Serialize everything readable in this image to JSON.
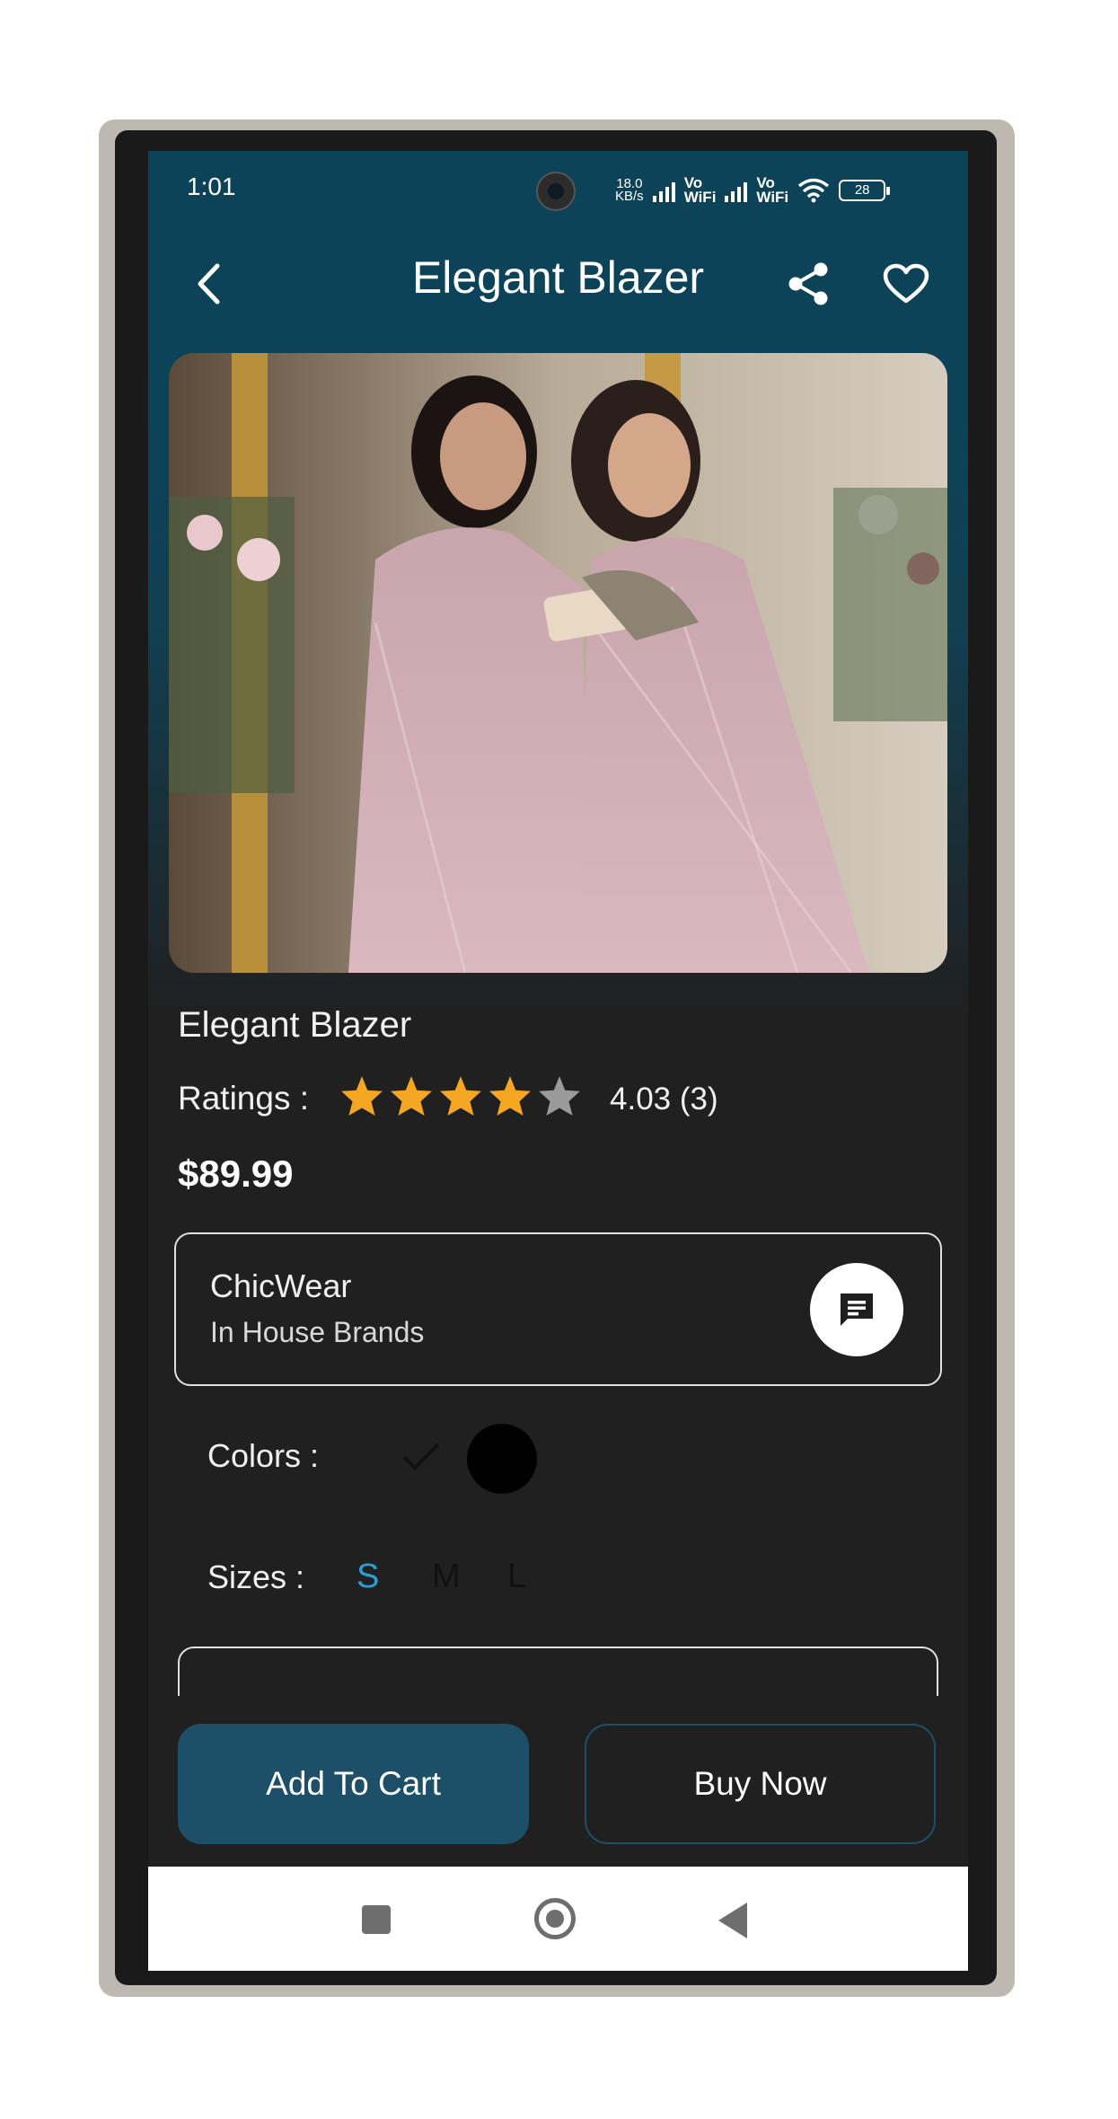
{
  "status_bar": {
    "time": "1:01",
    "net_speed_value": "18.0",
    "net_speed_unit": "KB/s",
    "vowifi_1_top": "Vo",
    "vowifi_1_bottom": "WiFi",
    "vowifi_2_top": "Vo",
    "vowifi_2_bottom": "WiFi",
    "battery": "28"
  },
  "app_bar": {
    "title": "Elegant Blazer",
    "back_icon": "chevron-left-icon",
    "share_icon": "share-icon",
    "favorite_icon": "heart-outline-icon"
  },
  "product": {
    "name": "Elegant Blazer",
    "ratings_label": "Ratings :",
    "rating": 4.03,
    "rating_text": "4.03 (3)",
    "stars_filled": 4,
    "stars_total": 5,
    "price": "$89.99"
  },
  "brand": {
    "name": "ChicWear",
    "category": "In House Brands",
    "chat_icon": "chat-message-icon"
  },
  "colors": {
    "label": "Colors :",
    "options": [
      "#ffffff",
      "#000000"
    ],
    "selected_index": 0
  },
  "sizes": {
    "label": "Sizes :",
    "options": [
      "S",
      "M",
      "L"
    ],
    "selected": "S"
  },
  "actions": {
    "add_to_cart": "Add To Cart",
    "buy_now": "Buy Now"
  },
  "theme": {
    "header_color": "#0c4358",
    "button_color": "#1d5068",
    "star_color": "#f5a623",
    "selected_size_color": "#2a9fd6"
  }
}
